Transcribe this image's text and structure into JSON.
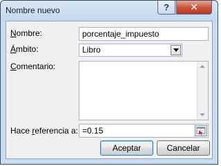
{
  "window": {
    "title": "Nombre nuevo",
    "help_label": "?",
    "close_label": "✕"
  },
  "form": {
    "name_label_accel": "N",
    "name_label_rest": "ombre:",
    "name_value": "porcentaje_impuesto",
    "scope_label_accel": "Á",
    "scope_label_rest": "mbito:",
    "scope_value": "Libro",
    "comment_label_accel": "C",
    "comment_label_rest": "omentario:",
    "comment_value": "",
    "ref_label_before": "Hace ",
    "ref_label_accel": "r",
    "ref_label_after": "eferencia a:",
    "ref_value": "=0.15"
  },
  "buttons": {
    "ok_label": "Aceptar",
    "cancel_label": "Cancelar"
  }
}
